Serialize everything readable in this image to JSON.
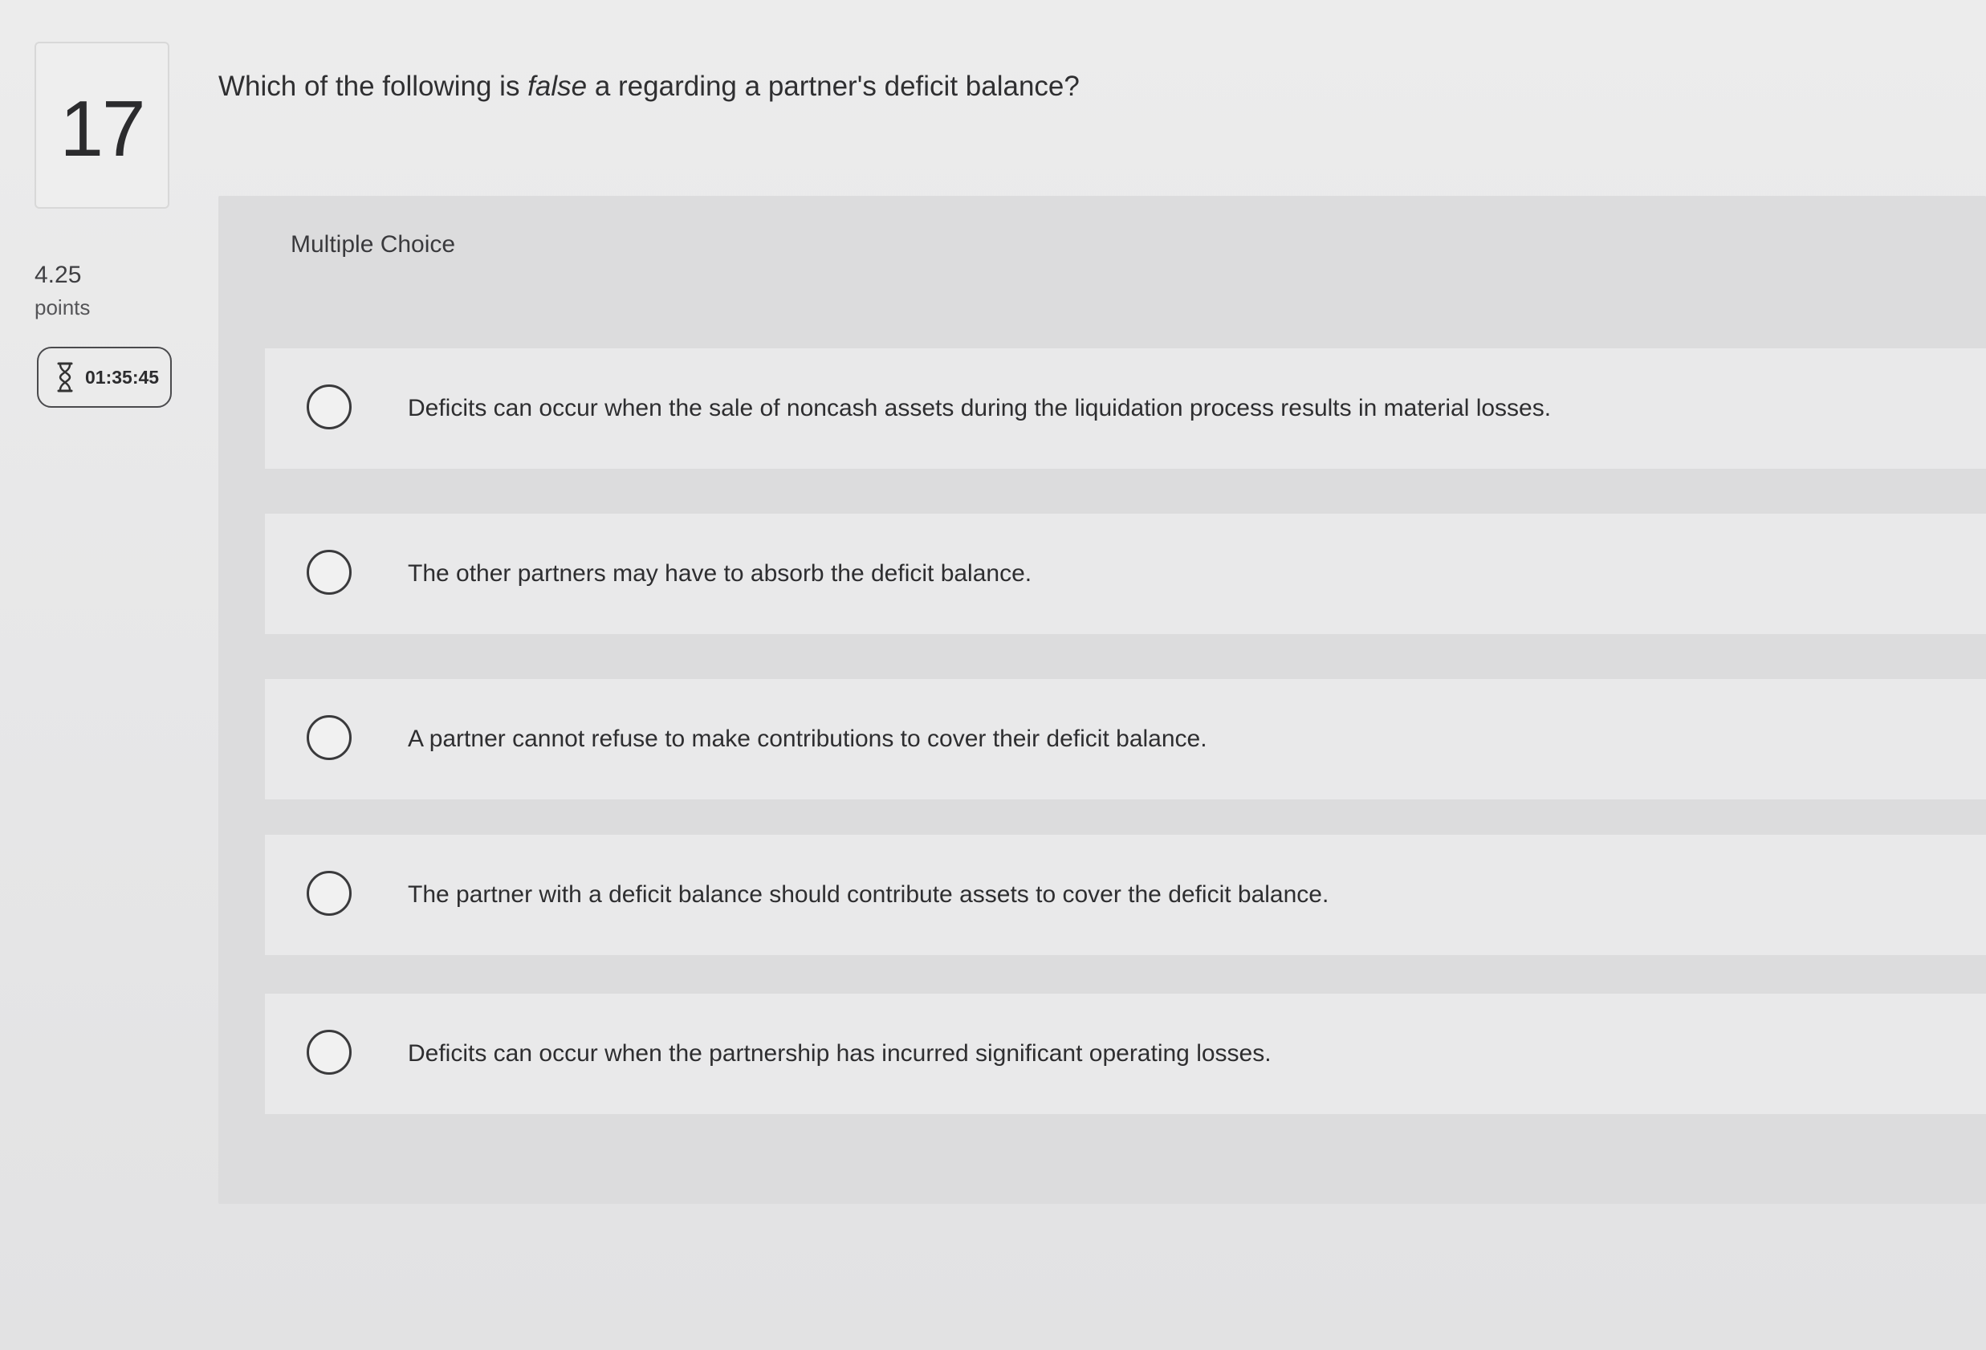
{
  "question": {
    "number": "17",
    "points_value": "4.25",
    "points_label": "points",
    "timer": "01:35:45",
    "timer_icon": "hourglass-icon",
    "text_before": "Which of the following is ",
    "text_emphasis": "false",
    "text_after": " a regarding a partner's deficit balance?"
  },
  "panel": {
    "header": "Multiple Choice"
  },
  "choices": [
    {
      "label": "Deficits can occur when the sale of noncash assets during the liquidation process results in material losses.",
      "selected": false
    },
    {
      "label": "The other partners may have to absorb the deficit balance.",
      "selected": false
    },
    {
      "label": "A partner cannot refuse to make contributions to cover their deficit balance.",
      "selected": false
    },
    {
      "label": "The partner with a deficit balance should contribute assets to cover the deficit balance.",
      "selected": false
    },
    {
      "label": "Deficits can occur when the partnership has incurred significant operating losses.",
      "selected": false
    }
  ]
}
